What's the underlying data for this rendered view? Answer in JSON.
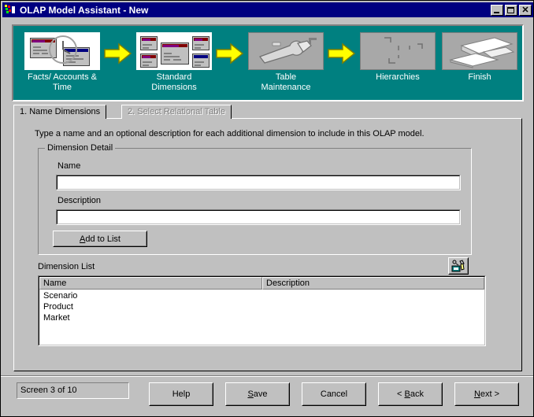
{
  "window": {
    "title": "OLAP Model Assistant - New",
    "icon": "olap-app-icon",
    "controls": {
      "minimize": "minimize-button",
      "maximize": "maximize-button",
      "close": "✕"
    }
  },
  "banner": {
    "background_color": "#008080",
    "steps": [
      {
        "caption": "Facts/ Accounts &\nTime",
        "state": "done",
        "icon": "facts-accounts-time-icon"
      },
      {
        "caption": "Standard\nDimensions",
        "state": "current",
        "icon": "standard-dimensions-icon"
      },
      {
        "caption": "Table\nMaintenance",
        "state": "pending",
        "icon": "table-maintenance-icon"
      },
      {
        "caption": "Hierarchies",
        "state": "pending",
        "icon": "hierarchies-icon"
      },
      {
        "caption": "Finish",
        "state": "pending",
        "icon": "finish-icon"
      }
    ],
    "arrow_color": "#ffff00"
  },
  "tabs": [
    {
      "label": "1. Name Dimensions",
      "active": true
    },
    {
      "label": "2. Select Relational Table",
      "active": false,
      "disabled": true
    }
  ],
  "page": {
    "instruction": "Type a name and an optional description for each additional dimension to include in this OLAP model.",
    "group": {
      "title": "Dimension Detail",
      "name_label": "Name",
      "name_value": "",
      "description_label": "Description",
      "description_value": "",
      "add_button": {
        "prefix": "",
        "accel": "A",
        "suffix": "dd to List"
      }
    },
    "list": {
      "label": "Dimension List",
      "tool_button": "delete-dimension-icon",
      "columns": [
        "Name",
        "Description"
      ],
      "rows": [
        {
          "name": "Scenario",
          "description": ""
        },
        {
          "name": "Product",
          "description": ""
        },
        {
          "name": "Market",
          "description": ""
        }
      ]
    }
  },
  "footer": {
    "status": "Screen 3 of 10",
    "buttons": [
      {
        "name": "help",
        "prefix": "Help",
        "accel": "",
        "suffix": ""
      },
      {
        "name": "save",
        "prefix": "",
        "accel": "S",
        "suffix": "ave"
      },
      {
        "name": "cancel",
        "prefix": "Cancel",
        "accel": "",
        "suffix": ""
      },
      {
        "name": "back",
        "prefix": "< ",
        "accel": "B",
        "suffix": "ack"
      },
      {
        "name": "next",
        "prefix": "",
        "accel": "N",
        "suffix": "ext >"
      }
    ]
  }
}
